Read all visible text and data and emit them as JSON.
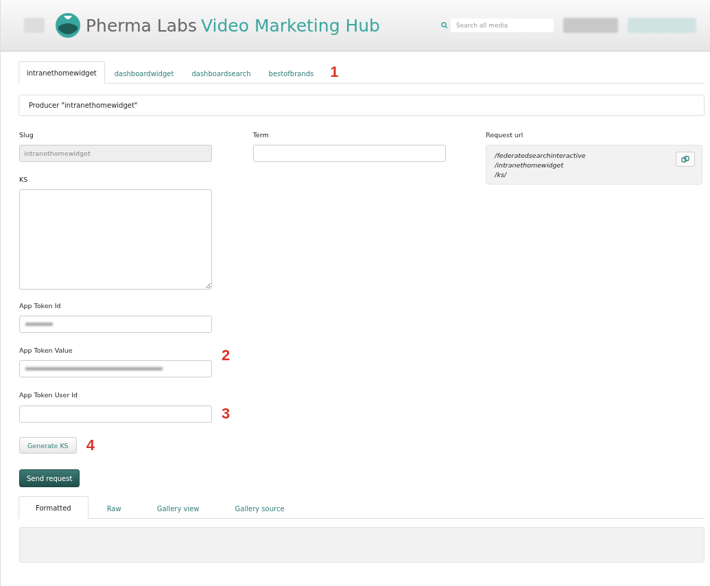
{
  "header": {
    "brand": "Pherma Labs",
    "product": "Video Marketing Hub",
    "search": {
      "placeholder": "Search all media"
    }
  },
  "tabs": [
    {
      "label": "intranethomewidget",
      "selected": true
    },
    {
      "label": "dashboardwidget",
      "selected": false
    },
    {
      "label": "dashboardsearch",
      "selected": false
    },
    {
      "label": "bestofbrands",
      "selected": false
    }
  ],
  "tabs_annotation": "1",
  "producer_title": "Producer \"intranethomewidget\"",
  "left_fields": [
    {
      "kind": "text",
      "label": "Slug",
      "value": "intranethomewidget",
      "disabled": true
    },
    {
      "kind": "textarea",
      "label": "KS"
    },
    {
      "kind": "blurred",
      "label": "App Token Id"
    },
    {
      "kind": "blurred",
      "label": "App Token Value",
      "annotation": "2"
    },
    {
      "kind": "text",
      "label": "App Token User Id",
      "annotation": "3"
    }
  ],
  "term": {
    "label": "Term"
  },
  "request_url": {
    "label": "Request url",
    "lines": [
      "/federatedsearchinteractive",
      "/intranethomewidget",
      "/ks/"
    ]
  },
  "generate_button": {
    "label": "Generate KS",
    "annotation": "4"
  },
  "send_button": {
    "label": "Send request"
  },
  "result_tabs": [
    {
      "label": "Formatted",
      "selected": true
    },
    {
      "label": "Raw",
      "selected": false
    },
    {
      "label": "Gallery view",
      "selected": false
    },
    {
      "label": "Gallery source",
      "selected": false
    }
  ]
}
